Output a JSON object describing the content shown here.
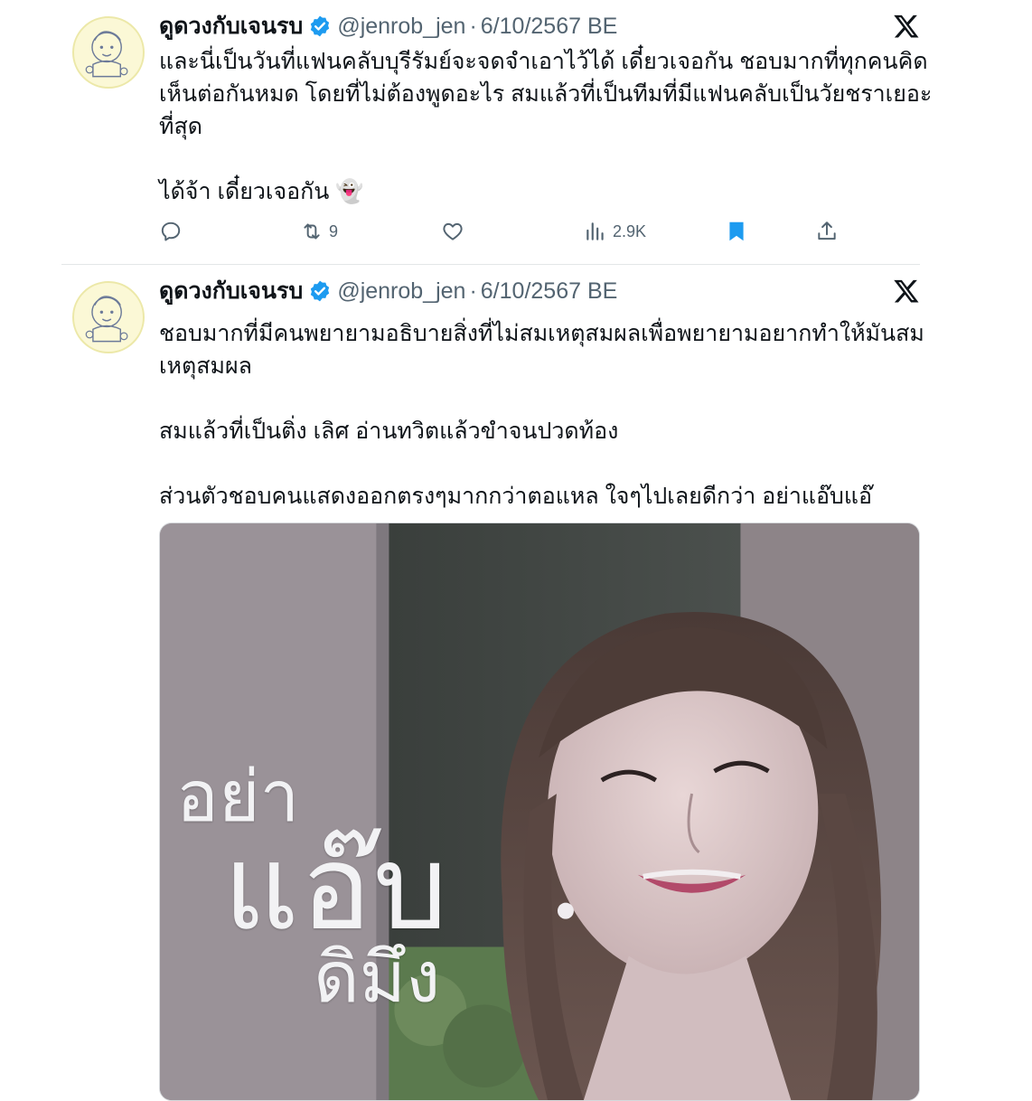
{
  "tweets": [
    {
      "author_name": "ดูดวงกับเจนรบ",
      "handle": "@jenrob_jen",
      "separator": "·",
      "date": "6/10/2567 BE",
      "text": "และนี่เป็นวันที่แฟนคลับบุรีรัมย์จะจดจำเอาไว้ได้ เดี๋ยวเจอกัน ชอบมากที่ทุกคนคิดเห็นต่อกันหมด โดยที่ไม่ต้องพูดอะไร สมแล้วที่เป็นทีมที่มีแฟนคลับเป็นวัยชราเยอะที่สุด\n\nได้จ้า เดี๋ยวเจอกัน 👻",
      "actions": {
        "reply_count": "",
        "retweet_count": "9",
        "like_count": "",
        "views_count": "2.9K"
      }
    },
    {
      "author_name": "ดูดวงกับเจนรบ",
      "handle": "@jenrob_jen",
      "separator": "·",
      "date": "6/10/2567 BE",
      "text": "ชอบมากที่มีคนพยายามอธิบายสิ่งที่ไม่สมเหตุสมผลเพื่อพยายามอยากทำให้มันสมเหตุสมผล\n\nสมแล้วที่เป็นติ่ง เลิศ อ่านทวิตแล้วขำจนปวดท้อง\n\nส่วนตัวชอบคนแสดงออกตรงๆมากกว่าตอแหล ใจๆไปเลยดีกว่า อย่าแอ๊บแอ๊",
      "media_overlay": [
        "อย่า",
        "แอ๊บ",
        "ดิมึง"
      ]
    }
  ],
  "icons": {
    "verified": "verified-badge-icon",
    "platform": "x-logo-icon",
    "reply": "reply-icon",
    "retweet": "retweet-icon",
    "like": "heart-icon",
    "views": "views-icon",
    "bookmark": "bookmark-icon",
    "share": "share-icon"
  },
  "colors": {
    "verified_blue": "#1d9bf0",
    "bookmark_blue": "#1d9bf0",
    "secondary_text": "#536471",
    "primary_text": "#0f1419"
  }
}
